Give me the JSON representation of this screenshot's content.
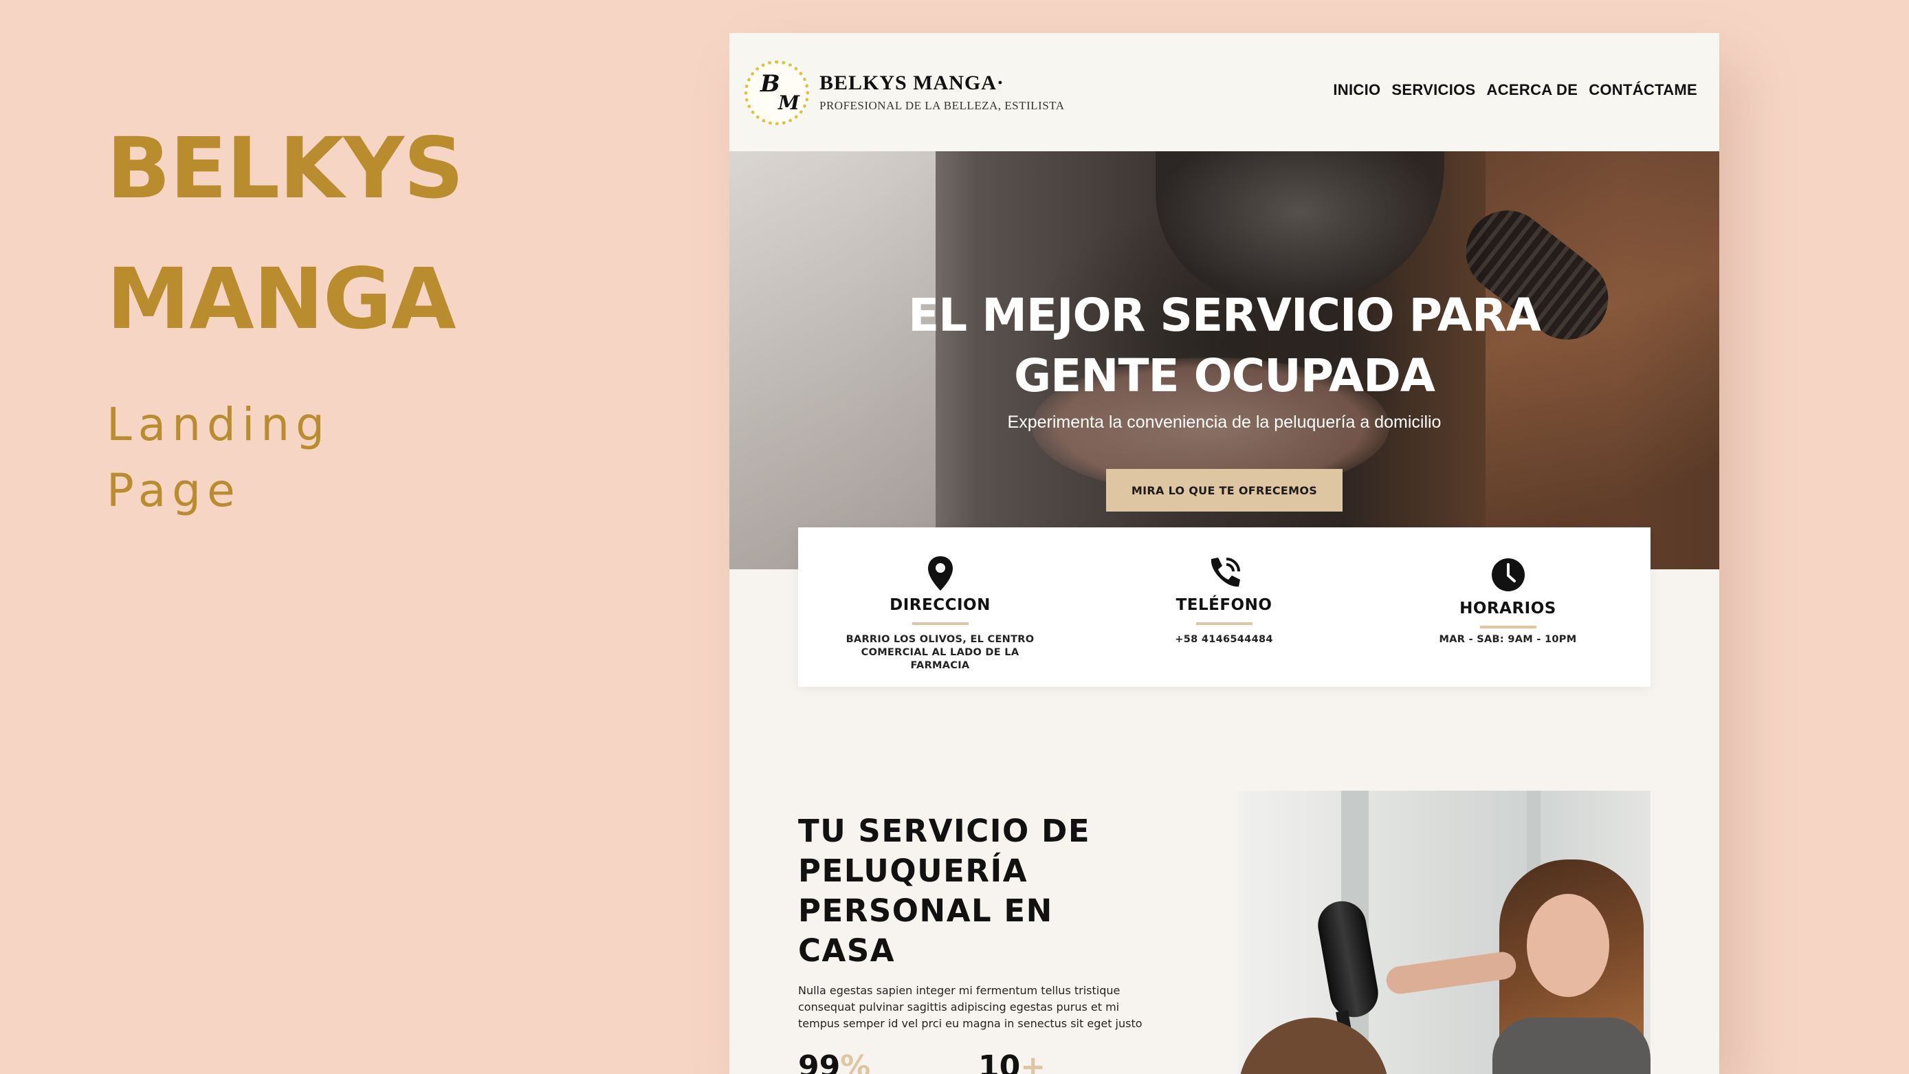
{
  "promo": {
    "line1": "BELKYS",
    "line2": "MANGA",
    "sub1": "Landing",
    "sub2": "Page"
  },
  "header": {
    "logo_letter_1": "B",
    "logo_letter_2": "M",
    "brand_name": "BELKYS MANGA·",
    "brand_tagline": "PROFESIONAL DE LA BELLEZA, ESTILISTA",
    "nav": [
      "INICIO",
      "SERVICIOS",
      "ACERCA DE",
      "CONTÁCTAME"
    ]
  },
  "hero": {
    "title_line1": "EL MEJOR SERVICIO PARA",
    "title_line2": "GENTE OCUPADA",
    "subtitle": "Experimenta la conveniencia de la peluquería a domicilio",
    "cta": "MIRA LO QUE TE OFRECEMOS"
  },
  "info": [
    {
      "icon": "location-pin-icon",
      "heading": "DIRECCION",
      "text": "BARRIO LOS OLIVOS, EL CENTRO COMERCIAL AL LADO DE LA FARMACIA"
    },
    {
      "icon": "phone-icon",
      "heading": "TELÉFONO",
      "text": "+58 4146544484"
    },
    {
      "icon": "clock-icon",
      "heading": "HORARIOS",
      "text": "MAR - SAB: 9AM - 10PM"
    }
  ],
  "service": {
    "title_lines": [
      "TU SERVICIO DE",
      "PELUQUERÍA",
      "PERSONAL EN",
      "CASA"
    ],
    "body": "Nulla egestas sapien integer mi fermentum tellus tristique consequat pulvinar sagittis adipiscing egestas purus et mi tempus semper id vel prci eu magna in senectus sit eget justo",
    "stat1_value": "99",
    "stat1_suffix": "%",
    "stat2_value": "10",
    "stat2_suffix": "+"
  },
  "colors": {
    "background": "#f7d5c5",
    "gold": "#b98d2e",
    "accent_beige": "#dfc6a2",
    "logo_dots": "#e0c33b"
  }
}
